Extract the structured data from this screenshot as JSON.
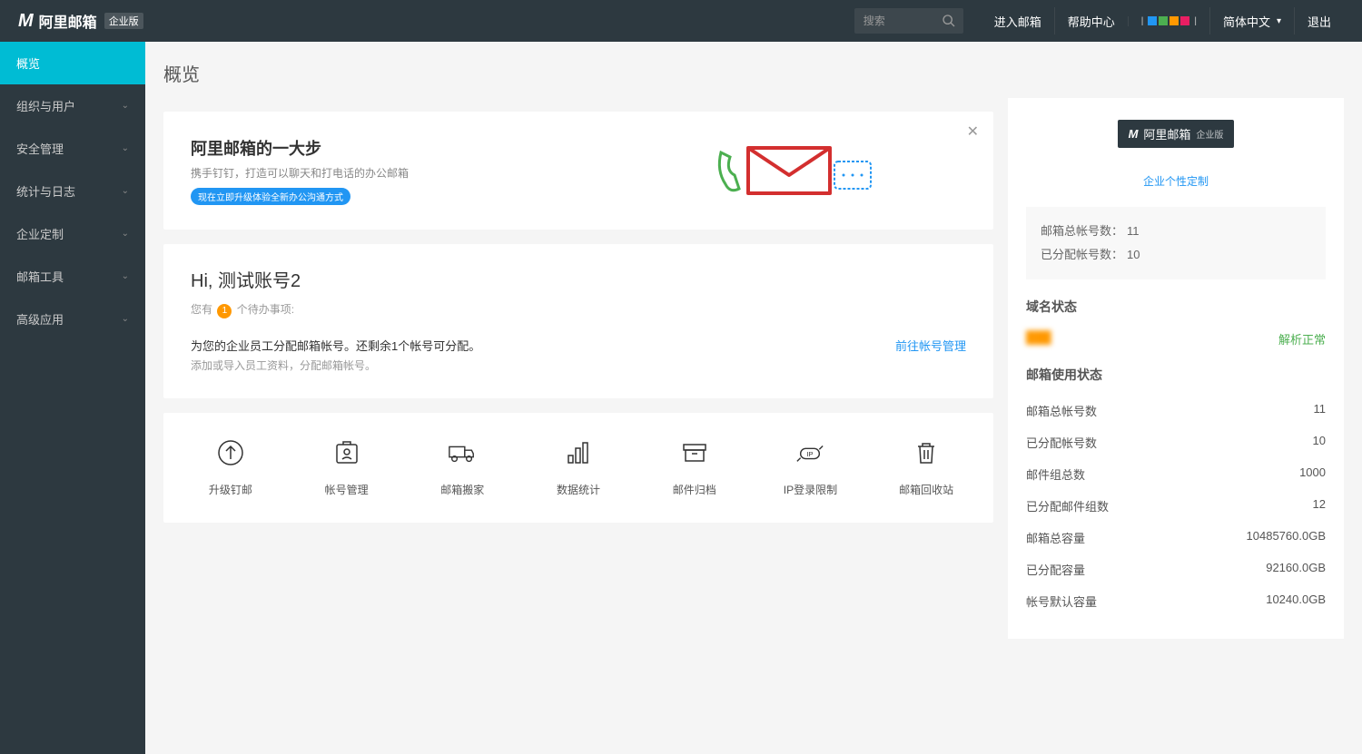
{
  "header": {
    "logo_text": "阿里邮箱",
    "logo_badge": "企业版",
    "search_placeholder": "搜索",
    "enter_mail": "进入邮箱",
    "help_center": "帮助中心",
    "language": "简体中文",
    "logout": "退出"
  },
  "sidebar": {
    "items": [
      {
        "label": "概览",
        "expandable": false
      },
      {
        "label": "组织与用户",
        "expandable": true
      },
      {
        "label": "安全管理",
        "expandable": true
      },
      {
        "label": "统计与日志",
        "expandable": true
      },
      {
        "label": "企业定制",
        "expandable": true
      },
      {
        "label": "邮箱工具",
        "expandable": true
      },
      {
        "label": "高级应用",
        "expandable": true
      }
    ]
  },
  "page": {
    "title": "概览"
  },
  "banner": {
    "title": "阿里邮箱的一大步",
    "subtitle": "携手钉钉，打造可以聊天和打电话的办公邮箱",
    "pill": "现在立即升级体验全新办公沟通方式"
  },
  "greeting": {
    "hello": "Hi, 测试账号2",
    "you_have": "您有",
    "todo_count": "1",
    "todo_suffix": "个待办事项:",
    "assign_text": "为您的企业员工分配邮箱帐号。还剩余1个帐号可分配。",
    "assign_sub": "添加或导入员工资料，分配邮箱帐号。",
    "assign_link": "前往帐号管理"
  },
  "quick_actions": [
    {
      "label": "升级钉邮"
    },
    {
      "label": "帐号管理"
    },
    {
      "label": "邮箱搬家"
    },
    {
      "label": "数据统计"
    },
    {
      "label": "邮件归档"
    },
    {
      "label": "IP登录限制"
    },
    {
      "label": "邮箱回收站"
    }
  ],
  "right": {
    "brand_text": "阿里邮箱",
    "brand_badge": "企业版",
    "custom_link": "企业个性定制",
    "stat1_label": "邮箱总帐号数：",
    "stat1_value": "11",
    "stat2_label": "已分配帐号数：",
    "stat2_value": "10",
    "domain_title": "域名状态",
    "domain_status": "解析正常",
    "usage_title": "邮箱使用状态",
    "usage": [
      {
        "label": "邮箱总帐号数",
        "value": "11"
      },
      {
        "label": "已分配帐号数",
        "value": "10"
      },
      {
        "label": "邮件组总数",
        "value": "1000"
      },
      {
        "label": "已分配邮件组数",
        "value": "12"
      },
      {
        "label": "邮箱总容量",
        "value": "10485760.0GB"
      },
      {
        "label": "已分配容量",
        "value": "92160.0GB"
      },
      {
        "label": "帐号默认容量",
        "value": "10240.0GB"
      }
    ]
  }
}
